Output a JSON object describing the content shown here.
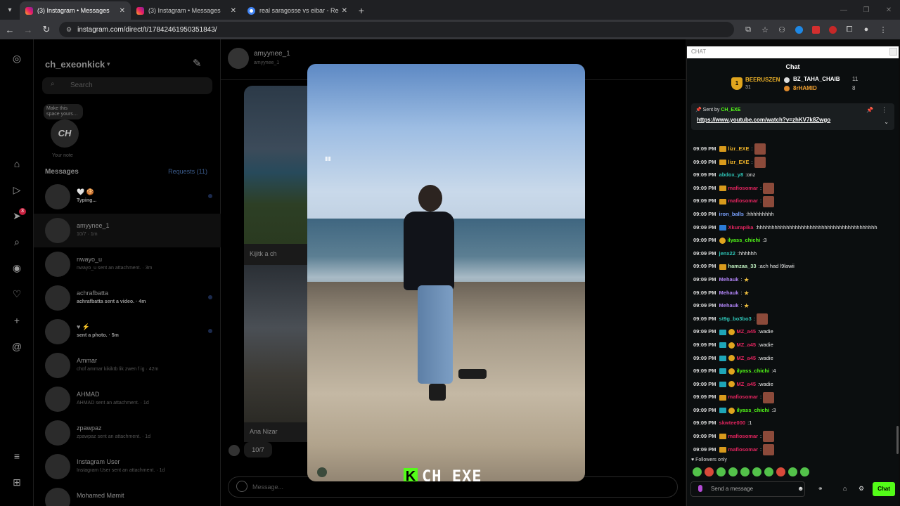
{
  "browser": {
    "tabs": [
      {
        "title": "(3) Instagram • Messages",
        "active": true
      },
      {
        "title": "(3) Instagram • Messages",
        "active": false
      },
      {
        "title": "real saragosse vs eibar - Recher",
        "active": false
      }
    ],
    "url": "instagram.com/direct/t/17842461950351843/"
  },
  "instagram": {
    "username": "ch_exeonkick",
    "search_placeholder": "Search",
    "note_bubble": "Make this space yours…",
    "note_logo": "CH",
    "note_caption": "Your note",
    "messages_label": "Messages",
    "requests_label": "Requests (11)",
    "rail_badge": "3",
    "conversations": [
      {
        "name": "🤍 🍪",
        "preview": "Typing...",
        "bold": true,
        "unread": true
      },
      {
        "name": "amyynee_1",
        "preview": "10/7 · 1m",
        "bold": false,
        "unread": false
      },
      {
        "name": "nwayo_u",
        "preview": "nwayo_u sent an attachment. · 3m",
        "bold": false,
        "unread": false
      },
      {
        "name": "achrafbatta",
        "preview": "achrafbatta sent a video. · 4m",
        "bold": true,
        "unread": true
      },
      {
        "name": "♥ ⚡",
        "preview": "sent a photo. · 5m",
        "bold": true,
        "unread": true
      },
      {
        "name": "Ammar",
        "preview": "chof ammar kikiktb lik zwen f ig · 42m",
        "bold": false,
        "unread": false
      },
      {
        "name": "AHMAD",
        "preview": "AHMAD sent an attachment. · 1d",
        "bold": false,
        "unread": false
      },
      {
        "name": "zpawpaz",
        "preview": "zpawpaz sent an attachment. · 1d",
        "bold": false,
        "unread": false
      },
      {
        "name": "Instagram User",
        "preview": "Instagram User sent an attachment. · 1d",
        "bold": false,
        "unread": false
      },
      {
        "name": "Mohamed Mømit",
        "preview": "",
        "bold": false,
        "unread": false
      }
    ],
    "thread": {
      "name": "amyynee_1",
      "sub": "amyynee_1",
      "caption1": "Kijitk a ch",
      "caption2": "Ana Nizar",
      "date_bubble": "10/7",
      "input_placeholder": "Message..."
    }
  },
  "media": {
    "watermark": "CH_EXE",
    "watermark_logo": "K"
  },
  "chat": {
    "popout_label": "CHAT",
    "title": "Chat",
    "leaderboard": [
      {
        "rank": "1",
        "name": "BEERUSZEN",
        "count": "31"
      },
      {
        "name": "BZ_TAHA_CHAIB",
        "count": "11"
      },
      {
        "name": "8rHAMID",
        "count": "8"
      }
    ],
    "pinned_by_label": "Sent by",
    "pinned_by": "CH_EXE",
    "pinned_url": "https://www.youtube.com/watch?v=zhKV7k8Zwgo",
    "messages": [
      {
        "time": "09:09 PM",
        "user": "lizr_EXE",
        "color": "#f0b429",
        "badge": "crown",
        "text": "",
        "emote": true
      },
      {
        "time": "09:09 PM",
        "user": "lizr_EXE",
        "color": "#f0b429",
        "badge": "crown",
        "text": "",
        "emote": true
      },
      {
        "time": "09:09 PM",
        "user": "abdox_y8",
        "color": "#2ec4b6",
        "badge": "",
        "text": "onz",
        "emote": false
      },
      {
        "time": "09:09 PM",
        "user": "mafiosomar",
        "color": "#e0245e",
        "badge": "crown",
        "text": "",
        "emote": true
      },
      {
        "time": "09:09 PM",
        "user": "mafiosomar",
        "color": "#e0245e",
        "badge": "crown",
        "text": "",
        "emote": true
      },
      {
        "time": "09:09 PM",
        "user": "iron_balls",
        "color": "#7aa2ff",
        "badge": "",
        "text": "hhhhhhhhh",
        "emote": false
      },
      {
        "time": "09:09 PM",
        "user": "Xkurapika",
        "color": "#e0245e",
        "badge": "blue",
        "text": "hhhhhhhhhhhhhhhhhhhhhhhhhhhhhhhhhhhhhhhhh",
        "emote": false
      },
      {
        "time": "09:09 PM",
        "user": "ilyass_chichi",
        "color": "#53fc18",
        "badge": "coin",
        "text": "3",
        "emote": false
      },
      {
        "time": "09:09 PM",
        "user": "jenx22",
        "color": "#2ec4b6",
        "badge": "",
        "text": "hhhhhh",
        "emote": false
      },
      {
        "time": "09:09 PM",
        "user": "hamzaa_33",
        "color": "#c0f0c0",
        "badge": "crown",
        "text": "ach had l9lawii",
        "emote": false
      },
      {
        "time": "09:09 PM",
        "user": "Mehauk",
        "color": "#b084f5",
        "badge": "",
        "text": "",
        "star": true
      },
      {
        "time": "09:09 PM",
        "user": "Mehauk",
        "color": "#b084f5",
        "badge": "",
        "text": "",
        "star": true
      },
      {
        "time": "09:09 PM",
        "user": "Mehauk",
        "color": "#b084f5",
        "badge": "",
        "text": "",
        "star": true
      },
      {
        "time": "09:09 PM",
        "user": "st9g_bo3bo3",
        "color": "#2ec4b6",
        "badge": "",
        "text": "",
        "emote": true
      },
      {
        "time": "09:09 PM",
        "user": "MZ_a45",
        "color": "#e0245e",
        "badge": "teal-coin",
        "text": "wadie",
        "emote": false
      },
      {
        "time": "09:09 PM",
        "user": "MZ_a45",
        "color": "#e0245e",
        "badge": "teal-coin",
        "text": "wadie",
        "emote": false
      },
      {
        "time": "09:09 PM",
        "user": "MZ_a45",
        "color": "#e0245e",
        "badge": "teal-coin",
        "text": "wadie",
        "emote": false
      },
      {
        "time": "09:09 PM",
        "user": "ilyass_chichi",
        "color": "#53fc18",
        "badge": "teal-coin",
        "text": "4",
        "emote": false
      },
      {
        "time": "09:09 PM",
        "user": "MZ_a45",
        "color": "#e0245e",
        "badge": "teal-coin",
        "text": "wadie",
        "emote": false
      },
      {
        "time": "09:09 PM",
        "user": "mafiosomar",
        "color": "#e0245e",
        "badge": "crown",
        "text": "",
        "emote": true
      },
      {
        "time": "09:09 PM",
        "user": "ilyass_chichi",
        "color": "#53fc18",
        "badge": "teal-coin",
        "text": "3",
        "emote": false
      },
      {
        "time": "09:09 PM",
        "user": "skwtee000",
        "color": "#e0245e",
        "badge": "",
        "text": "1",
        "emote": false
      },
      {
        "time": "09:09 PM",
        "user": "mafiosomar",
        "color": "#e0245e",
        "badge": "crown",
        "text": "",
        "emote": true
      },
      {
        "time": "09:09 PM",
        "user": "mafiosomar",
        "color": "#e0245e",
        "badge": "crown",
        "text": "",
        "emote": true
      }
    ],
    "followers_only": "Followers only",
    "input_placeholder": "Send a message",
    "send_label": "Chat",
    "accent": "#53fc18"
  }
}
